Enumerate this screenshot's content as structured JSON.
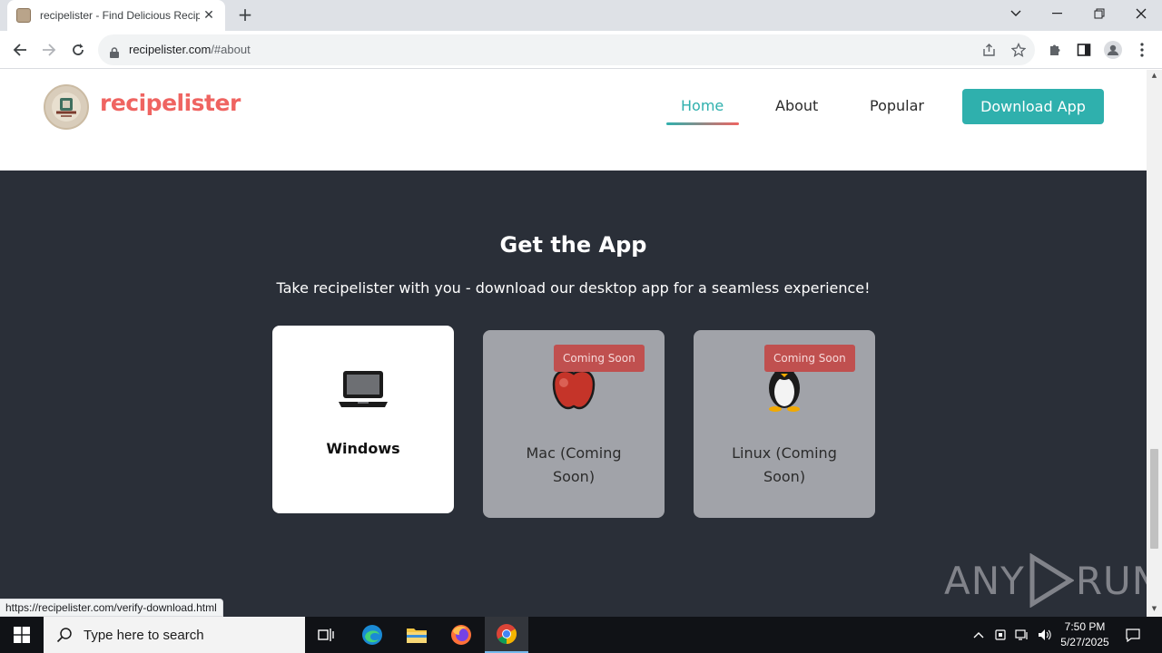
{
  "browser": {
    "tab_title": "recipelister - Find Delicious Recipes",
    "url_host": "recipelister.com",
    "url_path": "/#about",
    "status_url": "https://recipelister.com/verify-download.html"
  },
  "site": {
    "brand": "recipelister",
    "nav": [
      {
        "label": "Home"
      },
      {
        "label": "About"
      },
      {
        "label": "Popular"
      }
    ],
    "download_button": "Download App"
  },
  "get_app": {
    "title": "Get the App",
    "subtitle": "Take recipelister with you - download our desktop app for a seamless experience!",
    "cards": [
      {
        "label": "Windows",
        "icon": "laptop-icon"
      },
      {
        "label": "Mac (Coming Soon)",
        "line1": "Mac (Coming",
        "line2": "Soon)",
        "badge": "Coming Soon",
        "icon": "apple-icon"
      },
      {
        "label": "Linux (Coming Soon)",
        "line1": "Linux (Coming",
        "line2": "Soon)",
        "badge": "Coming Soon",
        "icon": "penguin-icon"
      }
    ]
  },
  "watermark": {
    "left": "ANY",
    "right": "RUN"
  },
  "taskbar": {
    "search_placeholder": "Type here to search",
    "time": "7:50 PM",
    "date": "5/27/2025"
  },
  "colors": {
    "brand": "#ef6461",
    "accent": "#2fb0ad",
    "section_bg": "#2a2f38",
    "badge": "#c0504f"
  }
}
